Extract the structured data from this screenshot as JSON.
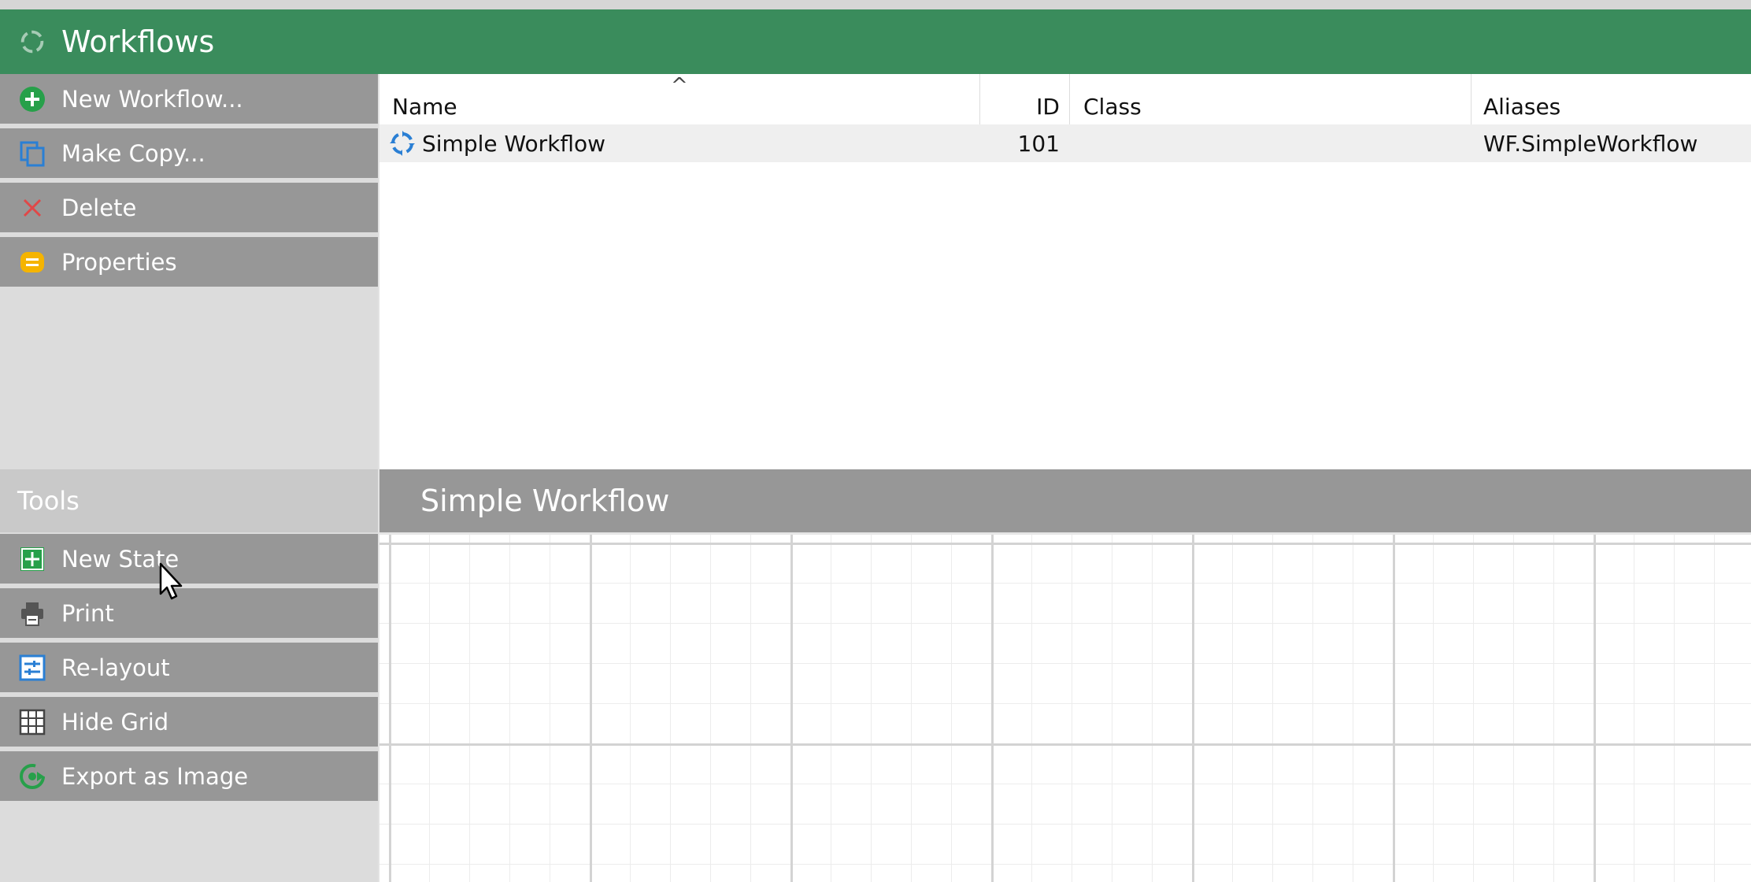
{
  "window": {
    "title": "Workflows",
    "title_icon": "workflow-cycle-icon",
    "header_color": "#3a8c5c"
  },
  "actions": [
    {
      "label": "New Workflow...",
      "icon": "plus-circle-icon",
      "color": "#27a04a"
    },
    {
      "label": "Make Copy...",
      "icon": "copy-icon",
      "color": "#2a7fd4"
    },
    {
      "label": "Delete",
      "icon": "close-icon",
      "color": "#e04848"
    },
    {
      "label": "Properties",
      "icon": "properties-icon",
      "color": "#f5b400"
    }
  ],
  "table": {
    "columns": [
      "Name",
      "ID",
      "Class",
      "Aliases"
    ],
    "sort": {
      "column": "Name",
      "direction": "ascending"
    },
    "rows": [
      {
        "name": "Simple Workflow",
        "id": "101",
        "class": "",
        "aliases": "WF.SimpleWorkflow",
        "icon": "workflow-cycle-icon"
      }
    ]
  },
  "tools": {
    "header": "Tools",
    "items": [
      {
        "label": "New State",
        "icon": "plus-square-icon",
        "color": "#27a04a"
      },
      {
        "label": "Print",
        "icon": "printer-icon",
        "color": "#555555"
      },
      {
        "label": "Re-layout",
        "icon": "relayout-icon",
        "color": "#2a7fd4"
      },
      {
        "label": "Hide Grid",
        "icon": "grid-icon",
        "color": "#555555"
      },
      {
        "label": "Export as Image",
        "icon": "export-image-icon",
        "color": "#27a04a"
      }
    ]
  },
  "canvas": {
    "title": "Simple Workflow"
  }
}
